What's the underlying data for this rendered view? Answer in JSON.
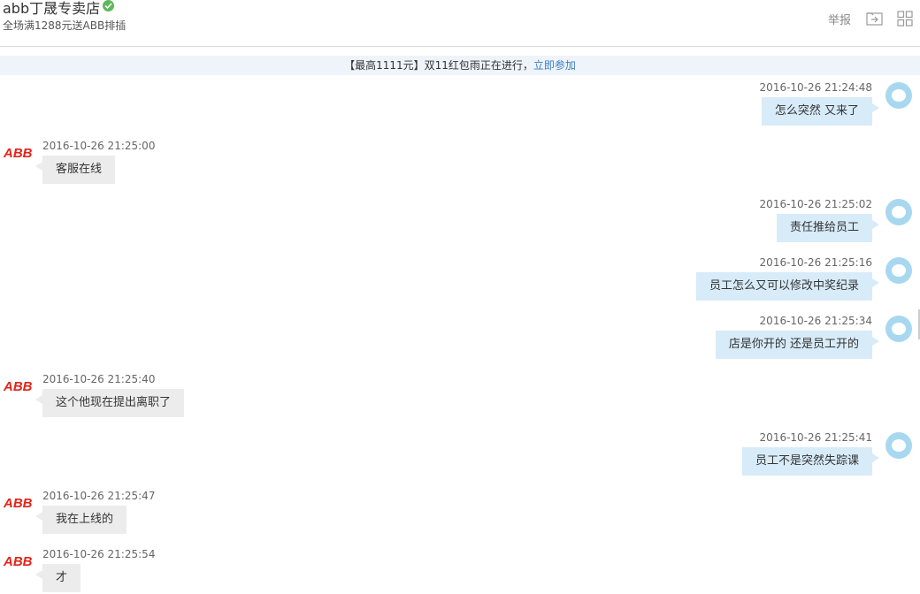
{
  "header": {
    "shop_name": "abb丁晟专卖店",
    "promo": "全场满1288元送ABB排插",
    "report_label": "举报",
    "verified_icon": "verified-check-icon",
    "icons": [
      "export-icon",
      "grid-icon"
    ]
  },
  "banner": {
    "text": "【最高1111元】双11红包雨正在进行，",
    "link": "立即参加"
  },
  "seller": {
    "logo_text": "ABB"
  },
  "messages": [
    {
      "side": "out",
      "time": "2016-10-26 21:24:48",
      "text": "怎么突然 又来了"
    },
    {
      "side": "in",
      "time": "2016-10-26 21:25:00",
      "text": "客服在线"
    },
    {
      "side": "out",
      "time": "2016-10-26 21:25:02",
      "text": "责任推给员工"
    },
    {
      "side": "out",
      "time": "2016-10-26 21:25:16",
      "text": "员工怎么又可以修改中奖纪录"
    },
    {
      "side": "out",
      "time": "2016-10-26 21:25:34",
      "text": "店是你开的  还是员工开的"
    },
    {
      "side": "in",
      "time": "2016-10-26 21:25:40",
      "text": "这个他现在提出离职了"
    },
    {
      "side": "out",
      "time": "2016-10-26 21:25:41",
      "text": "员工不是突然失踪课"
    },
    {
      "side": "in",
      "time": "2016-10-26 21:25:47",
      "text": "我在上线的"
    },
    {
      "side": "in",
      "time": "2016-10-26 21:25:54",
      "text": "才"
    }
  ],
  "colors": {
    "out_bubble": "#d7ebf9",
    "in_bubble": "#ececec",
    "banner_bg": "#eef4fa",
    "link": "#3a7fc1",
    "abb_red": "#e2241b",
    "verified": "#5cb85c"
  }
}
